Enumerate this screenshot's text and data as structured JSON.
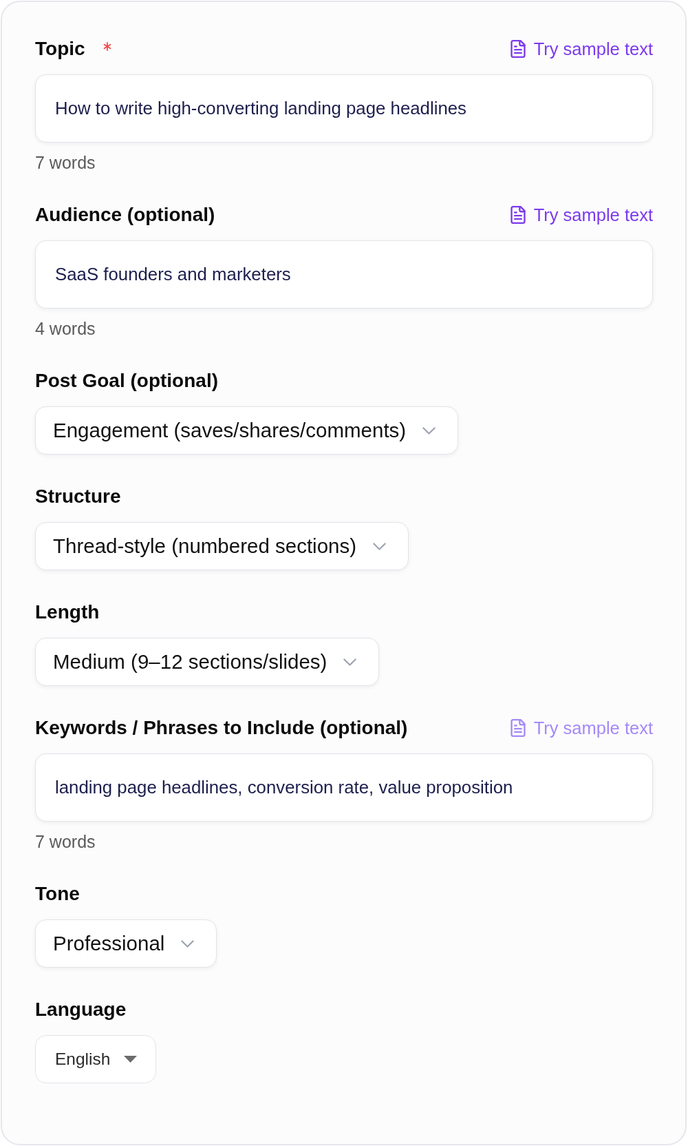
{
  "fields": [
    {
      "kind": "text",
      "label": "Topic",
      "required": true,
      "sample_link": {
        "label": "Try sample text",
        "disabled": false
      },
      "value": "How to write high-converting landing page headlines",
      "word_count": "7 words"
    },
    {
      "kind": "text",
      "label": "Audience (optional)",
      "required": false,
      "sample_link": {
        "label": "Try sample text",
        "disabled": false
      },
      "value": "SaaS founders and marketers",
      "word_count": "4 words"
    },
    {
      "kind": "select",
      "label": "Post Goal (optional)",
      "required": false,
      "value": "Engagement (saves/shares/comments)"
    },
    {
      "kind": "select",
      "label": "Structure",
      "required": false,
      "value": "Thread-style (numbered sections)"
    },
    {
      "kind": "select",
      "label": "Length",
      "required": false,
      "value": "Medium (9–12 sections/slides)"
    },
    {
      "kind": "text",
      "label": "Keywords / Phrases to Include (optional)",
      "required": false,
      "sample_link": {
        "label": "Try sample text",
        "disabled": true
      },
      "value": "landing page headlines, conversion rate, value proposition",
      "word_count": "7 words"
    },
    {
      "kind": "select",
      "label": "Tone",
      "required": false,
      "value": "Professional"
    },
    {
      "kind": "native",
      "label": "Language",
      "required": false,
      "value": "English"
    }
  ]
}
